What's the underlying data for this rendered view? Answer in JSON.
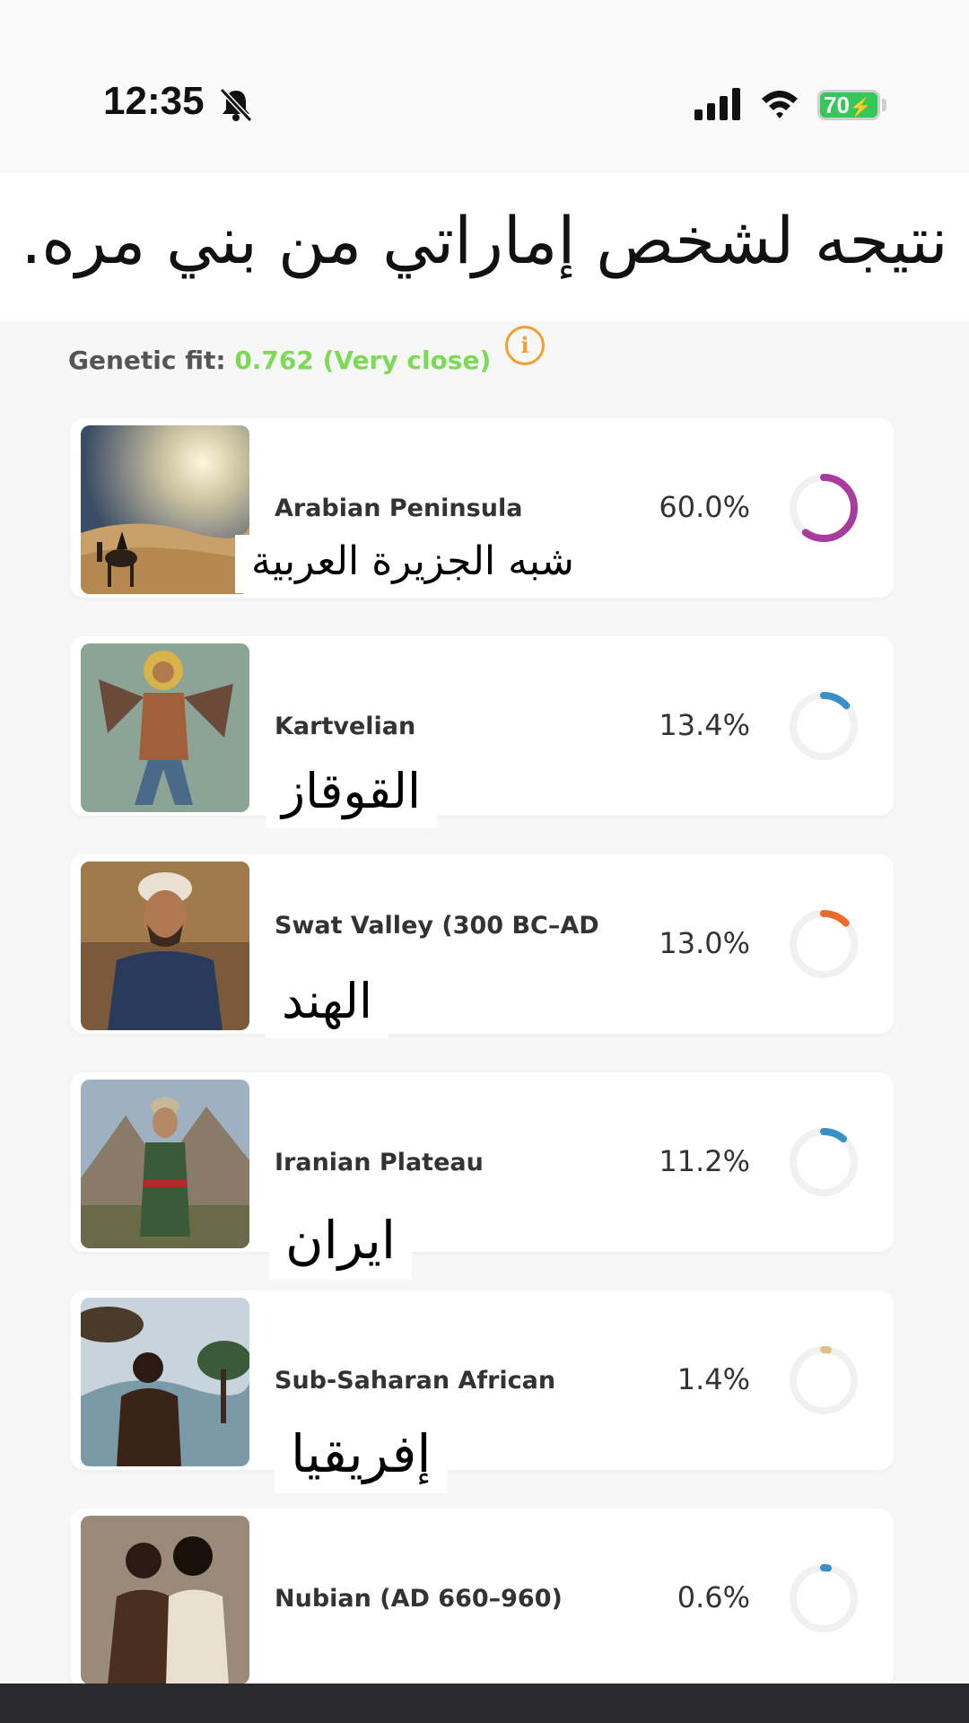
{
  "status_bar": {
    "time": "12:35",
    "battery": "70",
    "icons": [
      "bell-slash-icon",
      "signal-icon",
      "wifi-icon",
      "battery-charging-icon"
    ]
  },
  "caption": "نتيجه لشخص إماراتي من بني مره.",
  "genetic_fit": {
    "label": "Genetic fit:",
    "value": "0.762 (Very close)",
    "value_color": "#7ed957",
    "info_icon": "info-icon"
  },
  "populations": [
    {
      "name": "Arabian Peninsula",
      "percent": "60.0%",
      "fraction": 0.6,
      "color": "#a83c9e",
      "arabic_label": "شبه الجزيرة العربية"
    },
    {
      "name": "Kartvelian",
      "percent": "13.4%",
      "fraction": 0.134,
      "color": "#3b8fc9",
      "arabic_label": "القوقاز"
    },
    {
      "name": "Swat Valley (300 BC–AD",
      "percent": "13.0%",
      "fraction": 0.13,
      "color": "#ee6a2b",
      "arabic_label": "الهند"
    },
    {
      "name": "Iranian Plateau",
      "percent": "11.2%",
      "fraction": 0.112,
      "color": "#3b8fc9",
      "arabic_label": "ايران"
    },
    {
      "name": "Sub-Saharan African",
      "percent": "1.4%",
      "fraction": 0.014,
      "color": "#e0c27a",
      "arabic_label": "إفريقيا"
    },
    {
      "name": "Nubian (AD 660–960)",
      "percent": "0.6%",
      "fraction": 0.006,
      "color": "#3b8fc9",
      "arabic_label": ""
    }
  ]
}
